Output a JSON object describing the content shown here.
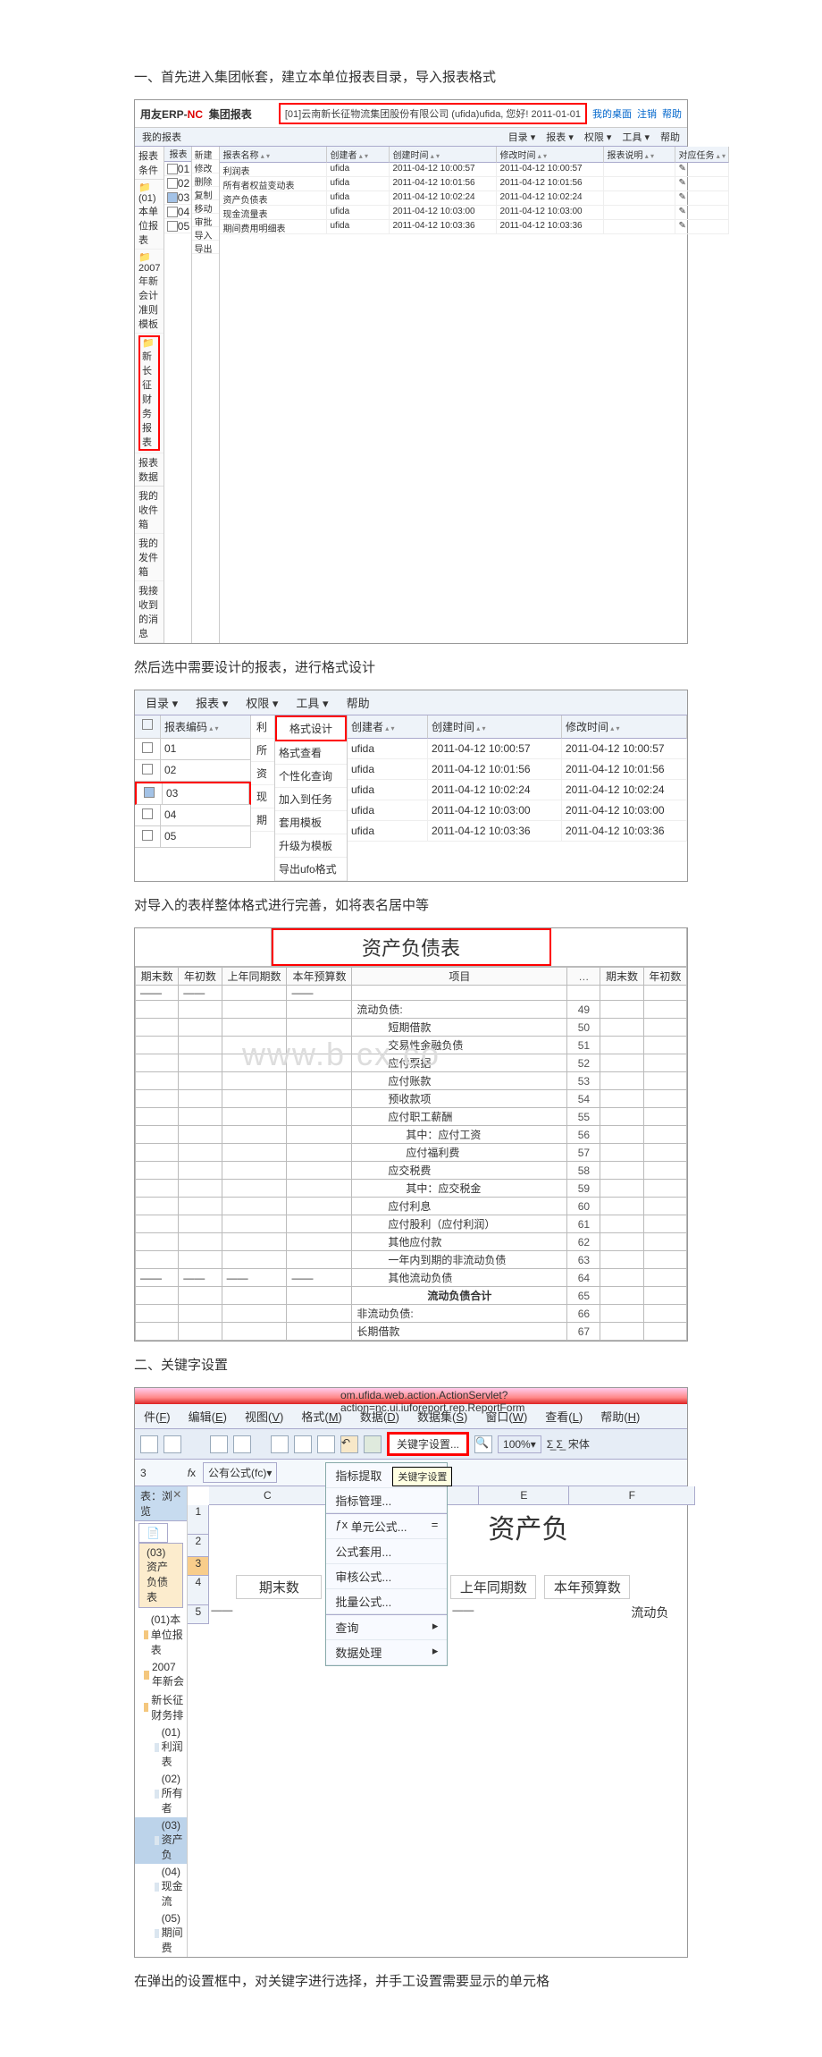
{
  "doc": {
    "heading1": "一、首先进入集团帐套，建立本单位报表目录，导入报表格式",
    "heading2": "然后选中需要设计的报表，进行格式设计",
    "heading3": "对导入的表样整体格式进行完善，如将表名居中等",
    "heading4": "二、关键字设置",
    "heading5": "在弹出的设置框中，对关键字进行选择，并手工设置需要显示的单元格"
  },
  "erp1": {
    "brand": "用友ERP-",
    "brand_suffix": "NC",
    "brand_sub": "集团报表",
    "company": "[01]云南新长征物流集团股份有限公司 (ufida)ufida, 您好! 2011-01-01",
    "top_links": [
      "我的桌面",
      "注销",
      "帮助"
    ],
    "menubar_left": "我的报表",
    "menubar": [
      "目录 ▾",
      "报表 ▾",
      "权限 ▾",
      "工具 ▾",
      "帮助"
    ],
    "sidebar": {
      "items": [
        "报表条件",
        "(01)本单位报表",
        "2007年新会计准则模板",
        "新长征财务报表",
        "报表数据",
        "我的收件箱",
        "我的发件箱",
        "我接收到的消息"
      ]
    },
    "submenu": [
      "新建",
      "修改",
      "删除",
      "复制",
      "移动",
      "审批",
      "导入",
      "导出"
    ],
    "checks": [
      "01",
      "02",
      "03",
      "04",
      "05"
    ],
    "check_state": [
      false,
      false,
      true,
      false,
      false
    ],
    "headers": [
      "报表名称",
      "创建者",
      "创建时间",
      "修改时间",
      "报表说明",
      "对应任务"
    ],
    "rows": [
      [
        "利润表",
        "ufida",
        "2011-04-12 10:00:57",
        "2011-04-12 10:00:57",
        "",
        "✎"
      ],
      [
        "所有者权益变动表",
        "ufida",
        "2011-04-12 10:01:56",
        "2011-04-12 10:01:56",
        "",
        "✎"
      ],
      [
        "资产负债表",
        "ufida",
        "2011-04-12 10:02:24",
        "2011-04-12 10:02:24",
        "",
        "✎"
      ],
      [
        "现金流量表",
        "ufida",
        "2011-04-12 10:03:00",
        "2011-04-12 10:03:00",
        "",
        "✎"
      ],
      [
        "期间费用明细表",
        "ufida",
        "2011-04-12 10:03:36",
        "2011-04-12 10:03:36",
        "",
        "✎"
      ]
    ]
  },
  "shot2": {
    "menubar": [
      "目录 ▾",
      "报表 ▾",
      "权限 ▾",
      "工具 ▾",
      "帮助"
    ],
    "code_header": "报表编码",
    "codes": [
      "01",
      "02",
      "03",
      "04",
      "05"
    ],
    "mid_top": "格式设计",
    "mid_items": [
      "格式查看",
      "个性化查询",
      "加入到任务",
      "套用模板",
      "升级为模板",
      "导出ufo格式"
    ],
    "sideletters": [
      "利",
      "所",
      "资",
      "现",
      "期"
    ],
    "headers": [
      "创建者",
      "创建时间",
      "修改时间"
    ],
    "rows": [
      [
        "ufida",
        "2011-04-12 10:00:57",
        "2011-04-12 10:00:57"
      ],
      [
        "ufida",
        "2011-04-12 10:01:56",
        "2011-04-12 10:01:56"
      ],
      [
        "ufida",
        "2011-04-12 10:02:24",
        "2011-04-12 10:02:24"
      ],
      [
        "ufida",
        "2011-04-12 10:03:00",
        "2011-04-12 10:03:00"
      ],
      [
        "ufida",
        "2011-04-12 10:03:36",
        "2011-04-12 10:03:36"
      ]
    ]
  },
  "shot3": {
    "title": "资产负债表",
    "left_headers": [
      "期末数",
      "年初数",
      "上年同期数",
      "本年预算数"
    ],
    "mid_header": "项目",
    "dot_header": "…",
    "right_headers": [
      "期末数",
      "年初数"
    ],
    "items": [
      {
        "r": 49,
        "t": "流动负债:"
      },
      {
        "r": 50,
        "t": "短期借款"
      },
      {
        "r": 51,
        "t": "交易性金融负债"
      },
      {
        "r": 52,
        "t": "应付票据"
      },
      {
        "r": 53,
        "t": "应付账款"
      },
      {
        "r": 54,
        "t": "预收款项"
      },
      {
        "r": 55,
        "t": "应付职工薪酬"
      },
      {
        "r": 56,
        "t": "其中：应付工资"
      },
      {
        "r": 57,
        "t": "应付福利费"
      },
      {
        "r": 58,
        "t": "应交税费"
      },
      {
        "r": 59,
        "t": "其中：应交税金"
      },
      {
        "r": 60,
        "t": "应付利息"
      },
      {
        "r": 61,
        "t": "应付股利（应付利润）"
      },
      {
        "r": 62,
        "t": "其他应付款"
      },
      {
        "r": 63,
        "t": "一年内到期的非流动负债"
      },
      {
        "r": 64,
        "t": "其他流动负债"
      },
      {
        "r": 65,
        "t": "流动负债合计"
      },
      {
        "r": 66,
        "t": "非流动负债:"
      },
      {
        "r": 67,
        "t": "长期借款"
      }
    ],
    "watermark": "www.b    cx.co"
  },
  "shot4": {
    "url": "om.ufida.web.action.ActionServlet?action=nc.ui.iuforeport.rep.ReportForm",
    "menu": [
      {
        "pre": "件(",
        "u": "F",
        "post": ")"
      },
      {
        "pre": "编辑(",
        "u": "E",
        "post": ")"
      },
      {
        "pre": "视图(",
        "u": "V",
        "post": ")"
      },
      {
        "pre": "格式(",
        "u": "M",
        "post": ")"
      },
      {
        "pre": "数据(",
        "u": "D",
        "post": ")"
      },
      {
        "pre": "数据集(",
        "u": "S",
        "post": ")"
      },
      {
        "pre": "窗口(",
        "u": "W",
        "post": ")"
      },
      {
        "pre": "查看(",
        "u": "L",
        "post": ")"
      },
      {
        "pre": "帮助(",
        "u": "H",
        "post": ")"
      }
    ],
    "keyword_btn": "关键字设置...",
    "tooltip": "关键字设置",
    "zoom": "100%",
    "font": "宋体",
    "cellref": "3",
    "fx_label": "公有公式(fc)",
    "dropdown": [
      "指标提取",
      "指标管理...",
      "",
      "单元公式...",
      "公式套用...",
      "审核公式...",
      "批量公式...",
      "",
      "查询",
      "数据处理"
    ],
    "equals": "=",
    "tree_tab": "表：浏览",
    "sheet_tab": "(03)资产负债表",
    "tree": [
      "(01)本单位报表",
      "2007年新会",
      "新长征财务排",
      "(01)利润表",
      "(02)所有者",
      "(03)资产负",
      "(04)现金流",
      "(05)期间费"
    ],
    "colC": "C",
    "colE": "E",
    "colF": "F",
    "row_labels": [
      "1",
      "2",
      "3",
      "4",
      "5"
    ],
    "big1": "资产负",
    "r4a": "期末数",
    "r4b": "上年同期数",
    "r4c": "本年预算数",
    "r5": "流动负",
    "arrow": "▸"
  }
}
